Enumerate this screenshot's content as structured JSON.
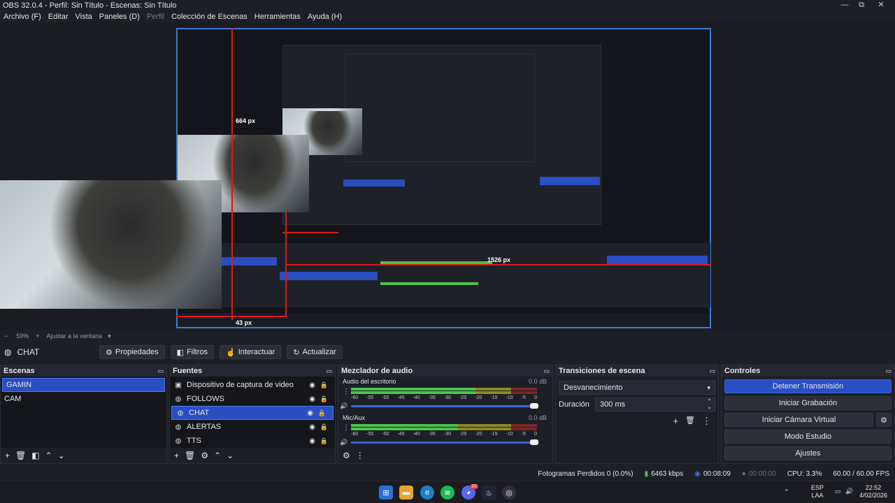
{
  "window": {
    "title": "OBS 32.0.4 - Perfil: Sin Título - Escenas: Sin Título",
    "controls": [
      "—",
      "⧉",
      "✕"
    ]
  },
  "menu": {
    "items": [
      {
        "label": "Archivo (F)",
        "enabled": true
      },
      {
        "label": "Editar",
        "enabled": true
      },
      {
        "label": "Vista",
        "enabled": true
      },
      {
        "label": "Paneles (D)",
        "enabled": true
      },
      {
        "label": "Perfil",
        "enabled": false
      },
      {
        "label": "Colección de Escenas",
        "enabled": true
      },
      {
        "label": "Herramientas",
        "enabled": true
      },
      {
        "label": "Ayuda (H)",
        "enabled": true
      }
    ]
  },
  "preview": {
    "measure_vertical": "664 px",
    "measure_horizontal": "43 px",
    "measure_right": "1526 px"
  },
  "zoom": {
    "minus": "−",
    "value": "59%",
    "plus": "+",
    "fit_label": "Ajustar a la ventana"
  },
  "source_toolbar": {
    "current_source": "CHAT",
    "properties": "Propiedades",
    "filters": "Filtros",
    "interact": "Interactuar",
    "refresh": "Actualizar"
  },
  "scenes": {
    "title": "Escenas",
    "items": [
      {
        "label": "GAMIN",
        "selected": true
      },
      {
        "label": "CAM",
        "selected": false
      }
    ]
  },
  "sources": {
    "title": "Fuentes",
    "items": [
      {
        "label": "Dispositivo de captura de video",
        "icon": "camera-icon",
        "selected": false
      },
      {
        "label": "FOLLOWS",
        "icon": "globe-icon",
        "selected": false
      },
      {
        "label": "CHAT",
        "icon": "globe-icon",
        "selected": true
      },
      {
        "label": "ALERTAS",
        "icon": "globe-icon",
        "selected": false
      },
      {
        "label": "TTS",
        "icon": "globe-icon",
        "selected": false
      }
    ]
  },
  "mixer": {
    "title": "Mezclador de audio",
    "ticks": [
      "-60",
      "-55",
      "-50",
      "-45",
      "-40",
      "-35",
      "-30",
      "-25",
      "-20",
      "-15",
      "-10",
      "-5",
      "0"
    ],
    "channels": [
      {
        "name": "Audio del escritorio",
        "db": "0.0 dB",
        "level": 0.67,
        "volume": 1.0
      },
      {
        "name": "Mic/Aux",
        "db": "0.0 dB",
        "level": 0.57,
        "volume": 1.0
      }
    ]
  },
  "transitions": {
    "title": "Transiciones de escena",
    "selected": "Desvanecimiento",
    "duration_label": "Duración",
    "duration_value": "300 ms"
  },
  "controls": {
    "title": "Controles",
    "stop_stream": "Detener Transmisión",
    "start_recording": "Iniciar Grabación",
    "start_virtual_cam": "Iniciar Cámara Virtual",
    "studio_mode": "Modo Estudio",
    "settings": "Ajustes"
  },
  "status": {
    "dropped_frames": "Fotogramas Perdidos 0 (0.0%)",
    "bitrate": "6463 kbps",
    "stream_time": "00:08:09",
    "rec_time": "00:00:00",
    "cpu": "CPU: 3.3%",
    "fps": "60.00 / 60.00 FPS"
  },
  "taskbar": {
    "lang_top": "ESP",
    "lang_bottom": "LAA",
    "time": "22:52",
    "date": "4/02/2026",
    "badge": "20"
  },
  "colors": {
    "accent": "#284fc4",
    "selection": "#2a4ebf",
    "measure_line": "#e01818",
    "meter_green": "#4cc34c"
  }
}
